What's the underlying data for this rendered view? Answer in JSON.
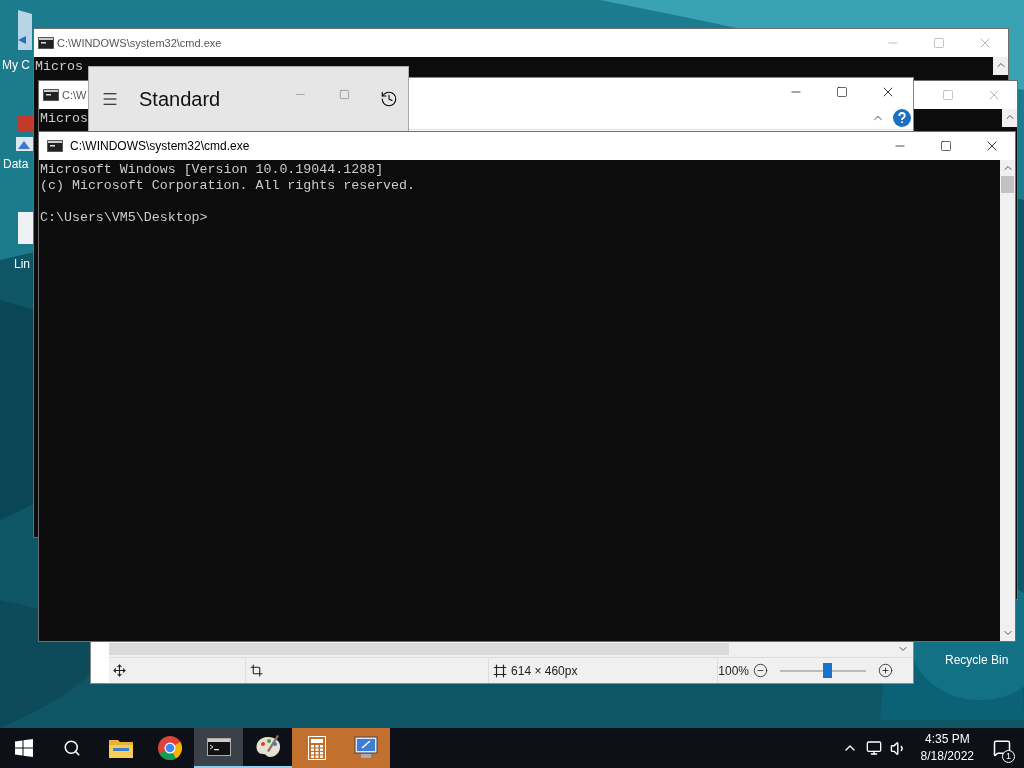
{
  "desktop_icons": [
    {
      "label": "My C"
    },
    {
      "label": "Data"
    },
    {
      "label": "Lin"
    },
    {
      "label": "Recycle Bin"
    }
  ],
  "back_console": {
    "title": "C:\\WINDOWS\\system32\\cmd.exe",
    "active": false,
    "lines": [
      "Micros"
    ]
  },
  "middle_console": {
    "title": "C:\\W",
    "active": false,
    "lines": [
      "Micros"
    ]
  },
  "paint": {
    "active": true,
    "size": "614 × 460px",
    "zoom": "100%",
    "zoom_slider": {
      "level": 0.55
    }
  },
  "calculator": {
    "title": "Standard"
  },
  "front_console": {
    "title": "C:\\WINDOWS\\system32\\cmd.exe",
    "active": true,
    "lines": [
      "Microsoft Windows [Version 10.0.19044.1288]",
      "(c) Microsoft Corporation. All rights reserved."
    ],
    "prompt": "C:\\Users\\VM5\\Desktop>"
  },
  "taskbar": {
    "items": [
      {
        "kind": "explorer",
        "active": false,
        "running": false,
        "flashing": false
      },
      {
        "kind": "chrome",
        "active": false,
        "running": false,
        "flashing": false
      },
      {
        "kind": "console",
        "active": true,
        "running": true,
        "flashing": false
      },
      {
        "kind": "paint",
        "active": false,
        "running": true,
        "flashing": false
      },
      {
        "kind": "calculator",
        "active": false,
        "running": false,
        "flashing": true
      },
      {
        "kind": "remote",
        "active": false,
        "running": false,
        "flashing": true
      }
    ],
    "time": "4:35 PM",
    "date": "8/18/2022",
    "notifications": "1"
  }
}
